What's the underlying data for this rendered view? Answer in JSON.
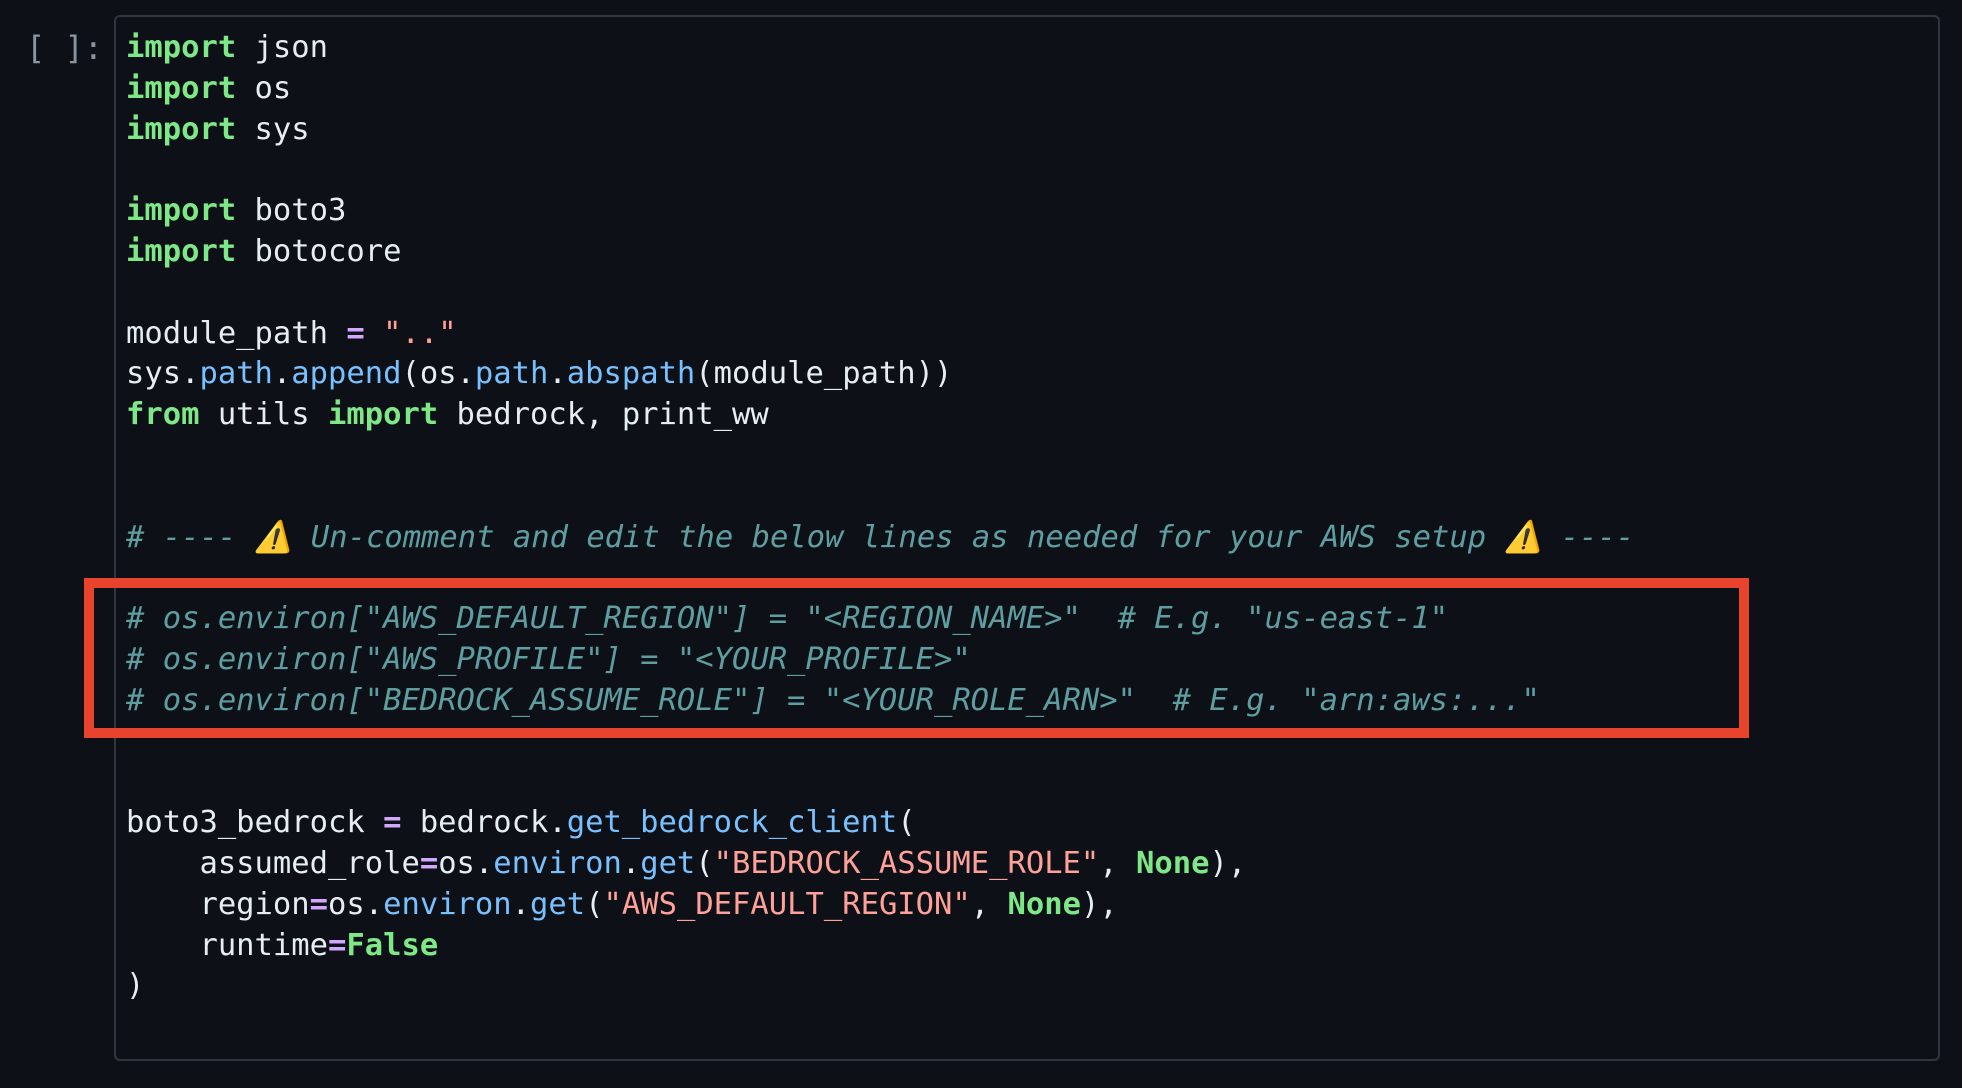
{
  "cell": {
    "prompt": "[ ]:",
    "lines": [
      [
        [
          "kw",
          "import"
        ],
        [
          "plain",
          " json"
        ]
      ],
      [
        [
          "kw",
          "import"
        ],
        [
          "plain",
          " os"
        ]
      ],
      [
        [
          "kw",
          "import"
        ],
        [
          "plain",
          " sys"
        ]
      ],
      [],
      [
        [
          "kw",
          "import"
        ],
        [
          "plain",
          " boto3"
        ]
      ],
      [
        [
          "kw",
          "import"
        ],
        [
          "plain",
          " botocore"
        ]
      ],
      [],
      [
        [
          "plain",
          "module_path "
        ],
        [
          "op",
          "="
        ],
        [
          "plain",
          " "
        ],
        [
          "str",
          "\"..\""
        ]
      ],
      [
        [
          "plain",
          "sys."
        ],
        [
          "attr",
          "path"
        ],
        [
          "plain",
          "."
        ],
        [
          "attr",
          "append"
        ],
        [
          "plain",
          "(os."
        ],
        [
          "attr",
          "path"
        ],
        [
          "plain",
          "."
        ],
        [
          "attr",
          "abspath"
        ],
        [
          "plain",
          "(module_path))"
        ]
      ],
      [
        [
          "kw",
          "from"
        ],
        [
          "plain",
          " utils "
        ],
        [
          "kw",
          "import"
        ],
        [
          "plain",
          " bedrock, print_ww"
        ]
      ],
      [],
      [],
      [
        [
          "cmt",
          "# ---- ⚠️ Un-comment and edit the below lines as needed for your AWS setup ⚠️ ----"
        ]
      ],
      [],
      [
        [
          "cmt",
          "# os.environ[\"AWS_DEFAULT_REGION\"] = \"<REGION_NAME>\"  # E.g. \"us-east-1\""
        ]
      ],
      [
        [
          "cmt",
          "# os.environ[\"AWS_PROFILE\"] = \"<YOUR_PROFILE>\""
        ]
      ],
      [
        [
          "cmt",
          "# os.environ[\"BEDROCK_ASSUME_ROLE\"] = \"<YOUR_ROLE_ARN>\"  # E.g. \"arn:aws:...\""
        ]
      ],
      [],
      [],
      [
        [
          "plain",
          "boto3_bedrock "
        ],
        [
          "op",
          "="
        ],
        [
          "plain",
          " bedrock."
        ],
        [
          "attr",
          "get_bedrock_client"
        ],
        [
          "plain",
          "("
        ]
      ],
      [
        [
          "plain",
          "    assumed_role"
        ],
        [
          "op",
          "="
        ],
        [
          "plain",
          "os."
        ],
        [
          "attr",
          "environ"
        ],
        [
          "plain",
          "."
        ],
        [
          "attr",
          "get"
        ],
        [
          "plain",
          "("
        ],
        [
          "str",
          "\"BEDROCK_ASSUME_ROLE\""
        ],
        [
          "plain",
          ", "
        ],
        [
          "const",
          "None"
        ],
        [
          "plain",
          "),"
        ]
      ],
      [
        [
          "plain",
          "    region"
        ],
        [
          "op",
          "="
        ],
        [
          "plain",
          "os."
        ],
        [
          "attr",
          "environ"
        ],
        [
          "plain",
          "."
        ],
        [
          "attr",
          "get"
        ],
        [
          "plain",
          "("
        ],
        [
          "str",
          "\"AWS_DEFAULT_REGION\""
        ],
        [
          "plain",
          ", "
        ],
        [
          "const",
          "None"
        ],
        [
          "plain",
          "),"
        ]
      ],
      [
        [
          "plain",
          "    runtime"
        ],
        [
          "op",
          "="
        ],
        [
          "const",
          "False"
        ]
      ],
      [
        [
          "plain",
          ")"
        ]
      ]
    ]
  },
  "colors": {
    "background": "#0d1117",
    "keyword": "#7ee787",
    "operator": "#d2a8ff",
    "string": "#ffa198",
    "attribute": "#79c0ff",
    "comment": "#5f9ea0",
    "highlight_box": "#e8432d"
  }
}
